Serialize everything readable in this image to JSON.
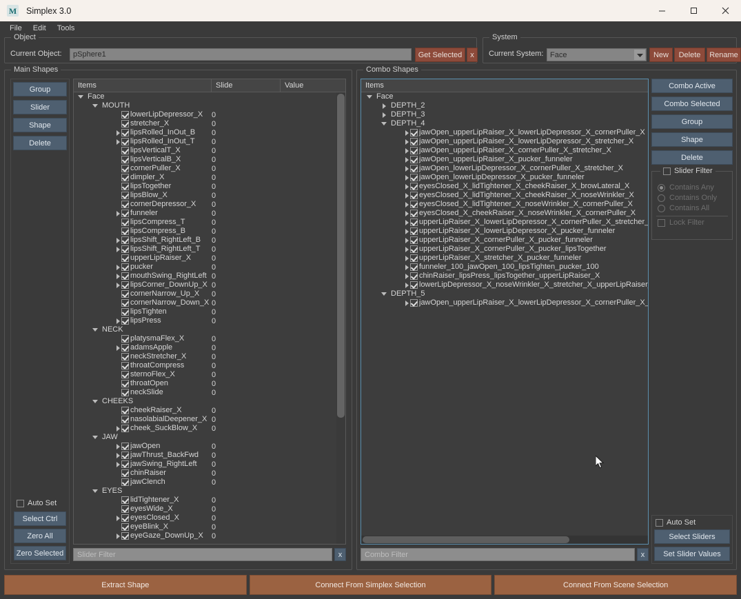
{
  "window": {
    "title": "Simplex 3.0",
    "icon": "M",
    "controls": {
      "minimize": "minimize-icon",
      "maximize": "maximize-icon",
      "close": "close-icon"
    }
  },
  "menubar": {
    "items": [
      "File",
      "Edit",
      "Tools"
    ]
  },
  "object_group": {
    "title": "Object",
    "current_object_label": "Current Object:",
    "current_object_value": "pSphere1",
    "get_selected_label": "Get Selected",
    "clear_label": "x"
  },
  "system_group": {
    "title": "System",
    "current_system_label": "Current System:",
    "current_system_value": "Face",
    "new_label": "New",
    "delete_label": "Delete",
    "rename_label": "Rename"
  },
  "main_shapes": {
    "title": "Main Shapes",
    "buttons": [
      "Group",
      "Slider",
      "Shape",
      "Delete"
    ],
    "columns": [
      "Items",
      "Slide",
      "Value"
    ],
    "auto_set_label": "Auto Set",
    "auto_set_checked": false,
    "bottom_buttons": [
      "Select Ctrl",
      "Zero All",
      "Zero Selected"
    ],
    "filter_placeholder": "Slider Filter",
    "filter_clear": "x",
    "tree": [
      {
        "label": "Face",
        "depth": 0,
        "type": "group",
        "expanded": true
      },
      {
        "label": "MOUTH",
        "depth": 1,
        "type": "group",
        "expanded": true
      },
      {
        "label": "lowerLipDepressor_X",
        "depth": 3,
        "type": "item",
        "value": "0",
        "arrow": false
      },
      {
        "label": "stretcher_X",
        "depth": 3,
        "type": "item",
        "value": "0",
        "arrow": false
      },
      {
        "label": "lipsRolled_InOut_B",
        "depth": 3,
        "type": "item",
        "value": "0",
        "arrow": true
      },
      {
        "label": "lipsRolled_InOut_T",
        "depth": 3,
        "type": "item",
        "value": "0",
        "arrow": true
      },
      {
        "label": "lipsVerticalT_X",
        "depth": 3,
        "type": "item",
        "value": "0",
        "arrow": false
      },
      {
        "label": "lipsVerticalB_X",
        "depth": 3,
        "type": "item",
        "value": "0",
        "arrow": false
      },
      {
        "label": "cornerPuller_X",
        "depth": 3,
        "type": "item",
        "value": "0",
        "arrow": false
      },
      {
        "label": "dimpler_X",
        "depth": 3,
        "type": "item",
        "value": "0",
        "arrow": false
      },
      {
        "label": "lipsTogether",
        "depth": 3,
        "type": "item",
        "value": "0",
        "arrow": false
      },
      {
        "label": "lipsBlow_X",
        "depth": 3,
        "type": "item",
        "value": "0",
        "arrow": false
      },
      {
        "label": "cornerDepressor_X",
        "depth": 3,
        "type": "item",
        "value": "0",
        "arrow": false
      },
      {
        "label": "funneler",
        "depth": 3,
        "type": "item",
        "value": "0",
        "arrow": true
      },
      {
        "label": "lipsCompress_T",
        "depth": 3,
        "type": "item",
        "value": "0",
        "arrow": false
      },
      {
        "label": "lipsCompress_B",
        "depth": 3,
        "type": "item",
        "value": "0",
        "arrow": false
      },
      {
        "label": "lipsShift_RightLeft_B",
        "depth": 3,
        "type": "item",
        "value": "0",
        "arrow": true
      },
      {
        "label": "lipsShift_RightLeft_T",
        "depth": 3,
        "type": "item",
        "value": "0",
        "arrow": true
      },
      {
        "label": "upperLipRaiser_X",
        "depth": 3,
        "type": "item",
        "value": "0",
        "arrow": false
      },
      {
        "label": "pucker",
        "depth": 3,
        "type": "item",
        "value": "0",
        "arrow": true
      },
      {
        "label": "mouthSwing_RightLeft",
        "depth": 3,
        "type": "item",
        "value": "0",
        "arrow": true
      },
      {
        "label": "lipsCorner_DownUp_X",
        "depth": 3,
        "type": "item",
        "value": "0",
        "arrow": true
      },
      {
        "label": "cornerNarrow_Up_X",
        "depth": 3,
        "type": "item",
        "value": "0",
        "arrow": false
      },
      {
        "label": "cornerNarrow_Down_X",
        "depth": 3,
        "type": "item",
        "value": "0",
        "arrow": false
      },
      {
        "label": "lipsTighten",
        "depth": 3,
        "type": "item",
        "value": "0",
        "arrow": false
      },
      {
        "label": "lipsPress",
        "depth": 3,
        "type": "item",
        "value": "0",
        "arrow": true
      },
      {
        "label": "NECK",
        "depth": 1,
        "type": "group",
        "expanded": true
      },
      {
        "label": "platysmaFlex_X",
        "depth": 3,
        "type": "item",
        "value": "0",
        "arrow": false
      },
      {
        "label": "adamsApple",
        "depth": 3,
        "type": "item",
        "value": "0",
        "arrow": true
      },
      {
        "label": "neckStretcher_X",
        "depth": 3,
        "type": "item",
        "value": "0",
        "arrow": false
      },
      {
        "label": "throatCompress",
        "depth": 3,
        "type": "item",
        "value": "0",
        "arrow": false
      },
      {
        "label": "sternoFlex_X",
        "depth": 3,
        "type": "item",
        "value": "0",
        "arrow": false
      },
      {
        "label": "throatOpen",
        "depth": 3,
        "type": "item",
        "value": "0",
        "arrow": false
      },
      {
        "label": "neckSlide",
        "depth": 3,
        "type": "item",
        "value": "0",
        "arrow": false
      },
      {
        "label": "CHEEKS",
        "depth": 1,
        "type": "group",
        "expanded": true
      },
      {
        "label": "cheekRaiser_X",
        "depth": 3,
        "type": "item",
        "value": "0",
        "arrow": false
      },
      {
        "label": "nasolabialDeepener_X",
        "depth": 3,
        "type": "item",
        "value": "0",
        "arrow": false
      },
      {
        "label": "cheek_SuckBlow_X",
        "depth": 3,
        "type": "item",
        "value": "0",
        "arrow": true
      },
      {
        "label": "JAW",
        "depth": 1,
        "type": "group",
        "expanded": true
      },
      {
        "label": "jawOpen",
        "depth": 3,
        "type": "item",
        "value": "0",
        "arrow": true
      },
      {
        "label": "jawThrust_BackFwd",
        "depth": 3,
        "type": "item",
        "value": "0",
        "arrow": true
      },
      {
        "label": "jawSwing_RightLeft",
        "depth": 3,
        "type": "item",
        "value": "0",
        "arrow": true
      },
      {
        "label": "chinRaiser",
        "depth": 3,
        "type": "item",
        "value": "0",
        "arrow": false
      },
      {
        "label": "jawClench",
        "depth": 3,
        "type": "item",
        "value": "0",
        "arrow": false
      },
      {
        "label": "EYES",
        "depth": 1,
        "type": "group",
        "expanded": true
      },
      {
        "label": "lidTightener_X",
        "depth": 3,
        "type": "item",
        "value": "0",
        "arrow": false
      },
      {
        "label": "eyesWide_X",
        "depth": 3,
        "type": "item",
        "value": "0",
        "arrow": false
      },
      {
        "label": "eyesClosed_X",
        "depth": 3,
        "type": "item",
        "value": "0",
        "arrow": true
      },
      {
        "label": "eyeBlink_X",
        "depth": 3,
        "type": "item",
        "value": "0",
        "arrow": false
      },
      {
        "label": "eyeGaze_DownUp_X",
        "depth": 3,
        "type": "item",
        "value": "0",
        "arrow": true
      }
    ]
  },
  "combo_shapes": {
    "title": "Combo Shapes",
    "columns": [
      "Items"
    ],
    "buttons": [
      "Combo Active",
      "Combo Selected",
      "Group",
      "Shape",
      "Delete"
    ],
    "slider_filter": {
      "label": "Slider Filter",
      "checked": false,
      "options": [
        "Contains Any",
        "Contains Only",
        "Contains All"
      ],
      "selected": "Contains Any",
      "lock_label": "Lock Filter",
      "lock_checked": false
    },
    "auto_set_label": "Auto Set",
    "auto_set_checked": false,
    "bottom_buttons": [
      "Select Sliders",
      "Set Slider Values"
    ],
    "filter_placeholder": "Combo Filter",
    "filter_clear": "x",
    "tree": [
      {
        "label": "Face",
        "depth": 0,
        "type": "group",
        "expanded": true
      },
      {
        "label": "DEPTH_2",
        "depth": 1,
        "type": "group",
        "expanded": false
      },
      {
        "label": "DEPTH_3",
        "depth": 1,
        "type": "group",
        "expanded": false
      },
      {
        "label": "DEPTH_4",
        "depth": 1,
        "type": "group",
        "expanded": true
      },
      {
        "label": "jawOpen_upperLipRaiser_X_lowerLipDepressor_X_cornerPuller_X",
        "depth": 3,
        "type": "item",
        "arrow": true
      },
      {
        "label": "jawOpen_upperLipRaiser_X_lowerLipDepressor_X_stretcher_X",
        "depth": 3,
        "type": "item",
        "arrow": true
      },
      {
        "label": "jawOpen_upperLipRaiser_X_cornerPuller_X_stretcher_X",
        "depth": 3,
        "type": "item",
        "arrow": true
      },
      {
        "label": "jawOpen_upperLipRaiser_X_pucker_funneler",
        "depth": 3,
        "type": "item",
        "arrow": true
      },
      {
        "label": "jawOpen_lowerLipDepressor_X_cornerPuller_X_stretcher_X",
        "depth": 3,
        "type": "item",
        "arrow": true
      },
      {
        "label": "jawOpen_lowerLipDepressor_X_pucker_funneler",
        "depth": 3,
        "type": "item",
        "arrow": true
      },
      {
        "label": "eyesClosed_X_lidTightener_X_cheekRaiser_X_browLateral_X",
        "depth": 3,
        "type": "item",
        "arrow": true
      },
      {
        "label": "eyesClosed_X_lidTightener_X_cheekRaiser_X_noseWrinkler_X",
        "depth": 3,
        "type": "item",
        "arrow": true
      },
      {
        "label": "eyesClosed_X_lidTightener_X_noseWrinkler_X_cornerPuller_X",
        "depth": 3,
        "type": "item",
        "arrow": true
      },
      {
        "label": "eyesClosed_X_cheekRaiser_X_noseWrinkler_X_cornerPuller_X",
        "depth": 3,
        "type": "item",
        "arrow": true
      },
      {
        "label": "upperLipRaiser_X_lowerLipDepressor_X_cornerPuller_X_stretcher_X",
        "depth": 3,
        "type": "item",
        "arrow": true
      },
      {
        "label": "upperLipRaiser_X_lowerLipDepressor_X_pucker_funneler",
        "depth": 3,
        "type": "item",
        "arrow": true
      },
      {
        "label": "upperLipRaiser_X_cornerPuller_X_pucker_funneler",
        "depth": 3,
        "type": "item",
        "arrow": true
      },
      {
        "label": "upperLipRaiser_X_cornerPuller_X_pucker_lipsTogether",
        "depth": 3,
        "type": "item",
        "arrow": true
      },
      {
        "label": "upperLipRaiser_X_stretcher_X_pucker_funneler",
        "depth": 3,
        "type": "item",
        "arrow": true
      },
      {
        "label": "funneler_100_jawOpen_100_lipsTighten_pucker_100",
        "depth": 3,
        "type": "item",
        "arrow": true
      },
      {
        "label": "chinRaiser_lipsPress_lipsTogether_upperLipRaiser_X",
        "depth": 3,
        "type": "item",
        "arrow": true
      },
      {
        "label": "lowerLipDepressor_X_noseWrinkler_X_stretcher_X_upperLipRaiser_X",
        "depth": 3,
        "type": "item",
        "arrow": true
      },
      {
        "label": "DEPTH_5",
        "depth": 1,
        "type": "group",
        "expanded": true
      },
      {
        "label": "jawOpen_upperLipRaiser_X_lowerLipDepressor_X_cornerPuller_X_stretch",
        "depth": 3,
        "type": "item",
        "arrow": true
      }
    ]
  },
  "action_bar": {
    "buttons": [
      "Extract Shape",
      "Connect From Simplex Selection",
      "Connect From Scene Selection"
    ]
  },
  "colors": {
    "window_bg": "#3a3a3a",
    "titlebar_bg": "#f6f1ec",
    "slate_button": "#4e5f70",
    "rust_button": "#8d4a3a",
    "action_button": "#9b6241",
    "panel_bg": "#3d3d3d",
    "focus_border": "#5b8fae",
    "input_bg": "#8d8d8d"
  }
}
